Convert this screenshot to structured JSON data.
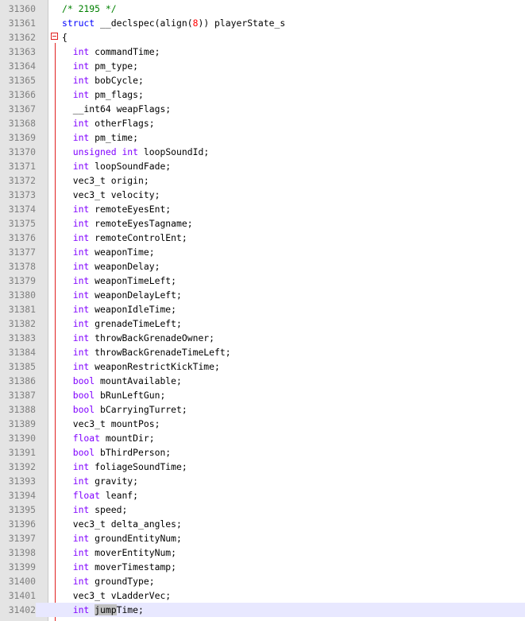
{
  "editor": {
    "lines": [
      {
        "num": "31360",
        "tokens": [
          {
            "t": "/* 2195 */",
            "c": "cmt"
          }
        ]
      },
      {
        "num": "31361",
        "tokens": [
          {
            "t": "struct",
            "c": "kw"
          },
          {
            "t": " __declspec(align(",
            "c": ""
          },
          {
            "t": "8",
            "c": "nm"
          },
          {
            "t": ")) playerState_s",
            "c": ""
          }
        ]
      },
      {
        "num": "31362",
        "tokens": [
          {
            "t": "{",
            "c": ""
          }
        ]
      },
      {
        "num": "31363",
        "tokens": [
          {
            "t": "  ",
            "c": ""
          },
          {
            "t": "int",
            "c": "ty"
          },
          {
            "t": " commandTime;",
            "c": ""
          }
        ]
      },
      {
        "num": "31364",
        "tokens": [
          {
            "t": "  ",
            "c": ""
          },
          {
            "t": "int",
            "c": "ty"
          },
          {
            "t": " pm_type;",
            "c": ""
          }
        ]
      },
      {
        "num": "31365",
        "tokens": [
          {
            "t": "  ",
            "c": ""
          },
          {
            "t": "int",
            "c": "ty"
          },
          {
            "t": " bobCycle;",
            "c": ""
          }
        ]
      },
      {
        "num": "31366",
        "tokens": [
          {
            "t": "  ",
            "c": ""
          },
          {
            "t": "int",
            "c": "ty"
          },
          {
            "t": " pm_flags;",
            "c": ""
          }
        ]
      },
      {
        "num": "31367",
        "tokens": [
          {
            "t": "  __int64 weapFlags;",
            "c": ""
          }
        ]
      },
      {
        "num": "31368",
        "tokens": [
          {
            "t": "  ",
            "c": ""
          },
          {
            "t": "int",
            "c": "ty"
          },
          {
            "t": " otherFlags;",
            "c": ""
          }
        ]
      },
      {
        "num": "31369",
        "tokens": [
          {
            "t": "  ",
            "c": ""
          },
          {
            "t": "int",
            "c": "ty"
          },
          {
            "t": " pm_time;",
            "c": ""
          }
        ]
      },
      {
        "num": "31370",
        "tokens": [
          {
            "t": "  ",
            "c": ""
          },
          {
            "t": "unsigned",
            "c": "ty"
          },
          {
            "t": " ",
            "c": ""
          },
          {
            "t": "int",
            "c": "ty"
          },
          {
            "t": " loopSoundId;",
            "c": ""
          }
        ]
      },
      {
        "num": "31371",
        "tokens": [
          {
            "t": "  ",
            "c": ""
          },
          {
            "t": "int",
            "c": "ty"
          },
          {
            "t": " loopSoundFade;",
            "c": ""
          }
        ]
      },
      {
        "num": "31372",
        "tokens": [
          {
            "t": "  vec3_t origin;",
            "c": ""
          }
        ]
      },
      {
        "num": "31373",
        "tokens": [
          {
            "t": "  vec3_t velocity;",
            "c": ""
          }
        ]
      },
      {
        "num": "31374",
        "tokens": [
          {
            "t": "  ",
            "c": ""
          },
          {
            "t": "int",
            "c": "ty"
          },
          {
            "t": " remoteEyesEnt;",
            "c": ""
          }
        ]
      },
      {
        "num": "31375",
        "tokens": [
          {
            "t": "  ",
            "c": ""
          },
          {
            "t": "int",
            "c": "ty"
          },
          {
            "t": " remoteEyesTagname;",
            "c": ""
          }
        ]
      },
      {
        "num": "31376",
        "tokens": [
          {
            "t": "  ",
            "c": ""
          },
          {
            "t": "int",
            "c": "ty"
          },
          {
            "t": " remoteControlEnt;",
            "c": ""
          }
        ]
      },
      {
        "num": "31377",
        "tokens": [
          {
            "t": "  ",
            "c": ""
          },
          {
            "t": "int",
            "c": "ty"
          },
          {
            "t": " weaponTime;",
            "c": ""
          }
        ]
      },
      {
        "num": "31378",
        "tokens": [
          {
            "t": "  ",
            "c": ""
          },
          {
            "t": "int",
            "c": "ty"
          },
          {
            "t": " weaponDelay;",
            "c": ""
          }
        ]
      },
      {
        "num": "31379",
        "tokens": [
          {
            "t": "  ",
            "c": ""
          },
          {
            "t": "int",
            "c": "ty"
          },
          {
            "t": " weaponTimeLeft;",
            "c": ""
          }
        ]
      },
      {
        "num": "31380",
        "tokens": [
          {
            "t": "  ",
            "c": ""
          },
          {
            "t": "int",
            "c": "ty"
          },
          {
            "t": " weaponDelayLeft;",
            "c": ""
          }
        ]
      },
      {
        "num": "31381",
        "tokens": [
          {
            "t": "  ",
            "c": ""
          },
          {
            "t": "int",
            "c": "ty"
          },
          {
            "t": " weaponIdleTime;",
            "c": ""
          }
        ]
      },
      {
        "num": "31382",
        "tokens": [
          {
            "t": "  ",
            "c": ""
          },
          {
            "t": "int",
            "c": "ty"
          },
          {
            "t": " grenadeTimeLeft;",
            "c": ""
          }
        ]
      },
      {
        "num": "31383",
        "tokens": [
          {
            "t": "  ",
            "c": ""
          },
          {
            "t": "int",
            "c": "ty"
          },
          {
            "t": " throwBackGrenadeOwner;",
            "c": ""
          }
        ]
      },
      {
        "num": "31384",
        "tokens": [
          {
            "t": "  ",
            "c": ""
          },
          {
            "t": "int",
            "c": "ty"
          },
          {
            "t": " throwBackGrenadeTimeLeft;",
            "c": ""
          }
        ]
      },
      {
        "num": "31385",
        "tokens": [
          {
            "t": "  ",
            "c": ""
          },
          {
            "t": "int",
            "c": "ty"
          },
          {
            "t": " weaponRestrictKickTime;",
            "c": ""
          }
        ]
      },
      {
        "num": "31386",
        "tokens": [
          {
            "t": "  ",
            "c": ""
          },
          {
            "t": "bool",
            "c": "ty"
          },
          {
            "t": " mountAvailable;",
            "c": ""
          }
        ]
      },
      {
        "num": "31387",
        "tokens": [
          {
            "t": "  ",
            "c": ""
          },
          {
            "t": "bool",
            "c": "ty"
          },
          {
            "t": " bRunLeftGun;",
            "c": ""
          }
        ]
      },
      {
        "num": "31388",
        "tokens": [
          {
            "t": "  ",
            "c": ""
          },
          {
            "t": "bool",
            "c": "ty"
          },
          {
            "t": " bCarryingTurret;",
            "c": ""
          }
        ]
      },
      {
        "num": "31389",
        "tokens": [
          {
            "t": "  vec3_t mountPos;",
            "c": ""
          }
        ]
      },
      {
        "num": "31390",
        "tokens": [
          {
            "t": "  ",
            "c": ""
          },
          {
            "t": "float",
            "c": "ty"
          },
          {
            "t": " mountDir;",
            "c": ""
          }
        ]
      },
      {
        "num": "31391",
        "tokens": [
          {
            "t": "  ",
            "c": ""
          },
          {
            "t": "bool",
            "c": "ty"
          },
          {
            "t": " bThirdPerson;",
            "c": ""
          }
        ]
      },
      {
        "num": "31392",
        "tokens": [
          {
            "t": "  ",
            "c": ""
          },
          {
            "t": "int",
            "c": "ty"
          },
          {
            "t": " foliageSoundTime;",
            "c": ""
          }
        ]
      },
      {
        "num": "31393",
        "tokens": [
          {
            "t": "  ",
            "c": ""
          },
          {
            "t": "int",
            "c": "ty"
          },
          {
            "t": " gravity;",
            "c": ""
          }
        ]
      },
      {
        "num": "31394",
        "tokens": [
          {
            "t": "  ",
            "c": ""
          },
          {
            "t": "float",
            "c": "ty"
          },
          {
            "t": " leanf;",
            "c": ""
          }
        ]
      },
      {
        "num": "31395",
        "tokens": [
          {
            "t": "  ",
            "c": ""
          },
          {
            "t": "int",
            "c": "ty"
          },
          {
            "t": " speed;",
            "c": ""
          }
        ]
      },
      {
        "num": "31396",
        "tokens": [
          {
            "t": "  vec3_t delta_angles;",
            "c": ""
          }
        ]
      },
      {
        "num": "31397",
        "tokens": [
          {
            "t": "  ",
            "c": ""
          },
          {
            "t": "int",
            "c": "ty"
          },
          {
            "t": " groundEntityNum;",
            "c": ""
          }
        ]
      },
      {
        "num": "31398",
        "tokens": [
          {
            "t": "  ",
            "c": ""
          },
          {
            "t": "int",
            "c": "ty"
          },
          {
            "t": " moverEntityNum;",
            "c": ""
          }
        ]
      },
      {
        "num": "31399",
        "tokens": [
          {
            "t": "  ",
            "c": ""
          },
          {
            "t": "int",
            "c": "ty"
          },
          {
            "t": " moverTimestamp;",
            "c": ""
          }
        ]
      },
      {
        "num": "31400",
        "tokens": [
          {
            "t": "  ",
            "c": ""
          },
          {
            "t": "int",
            "c": "ty"
          },
          {
            "t": " groundType;",
            "c": ""
          }
        ]
      },
      {
        "num": "31401",
        "tokens": [
          {
            "t": "  vec3_t vLadderVec;",
            "c": ""
          }
        ]
      },
      {
        "num": "31402",
        "current": true,
        "tokens": [
          {
            "t": "  ",
            "c": ""
          },
          {
            "t": "int",
            "c": "ty"
          },
          {
            "t": " ",
            "c": ""
          },
          {
            "t": "jump",
            "c": "hl"
          },
          {
            "t": "Time;",
            "c": ""
          }
        ]
      }
    ]
  }
}
